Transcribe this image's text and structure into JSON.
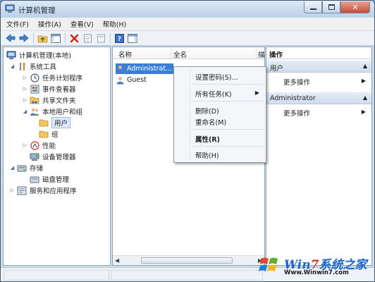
{
  "window": {
    "title": "计算机管理"
  },
  "menubar": {
    "items": [
      "文件(F)",
      "操作(A)",
      "查看(V)",
      "帮助(H)"
    ]
  },
  "toolbar": {
    "buttons": [
      "back-icon",
      "forward-icon",
      "up-folder-icon",
      "console-tree-icon",
      "delete-icon",
      "properties-icon",
      "export-icon",
      "help-icon",
      "show-hide-action-icon"
    ]
  },
  "tree": {
    "root": "计算机管理(本地)",
    "items": [
      {
        "label": "系统工具",
        "level": 1,
        "expander": "◢"
      },
      {
        "label": "任务计划程序",
        "level": 2,
        "expander": "▷"
      },
      {
        "label": "事件查看器",
        "level": 2,
        "expander": "▷"
      },
      {
        "label": "共享文件夹",
        "level": 2,
        "expander": "▷"
      },
      {
        "label": "本地用户和组",
        "level": 2,
        "expander": "◢"
      },
      {
        "label": "用户",
        "level": 3,
        "expander": ""
      },
      {
        "label": "组",
        "level": 3,
        "expander": ""
      },
      {
        "label": "性能",
        "level": 2,
        "expander": "▷"
      },
      {
        "label": "设备管理器",
        "level": 2,
        "expander": ""
      },
      {
        "label": "存储",
        "level": 1,
        "expander": "◢"
      },
      {
        "label": "磁盘管理",
        "level": 2,
        "expander": ""
      },
      {
        "label": "服务和应用程序",
        "level": 1,
        "expander": "▷"
      }
    ]
  },
  "list": {
    "columns": [
      "名称",
      "全名",
      "描"
    ],
    "rows": [
      "Administrat...",
      "Guest"
    ]
  },
  "context_menu": {
    "items": [
      "设置密码(S)...",
      "所有任务(K)",
      "删除(D)",
      "重命名(M)",
      "属性(R)",
      "帮助(H)"
    ]
  },
  "actions": {
    "title": "操作",
    "groups": [
      {
        "header": "用户",
        "item": "更多操作"
      },
      {
        "header": "Administrator",
        "item": "更多操作"
      }
    ]
  },
  "watermark": {
    "brand_a": "Win",
    "brand_7": "7",
    "brand_b": "系统之家",
    "url": "Www.Winwin7.com"
  },
  "colors": {
    "selection": "#3b7ed6",
    "title_gradient_top": "#dce8f5",
    "action_group": "#cfdced"
  }
}
